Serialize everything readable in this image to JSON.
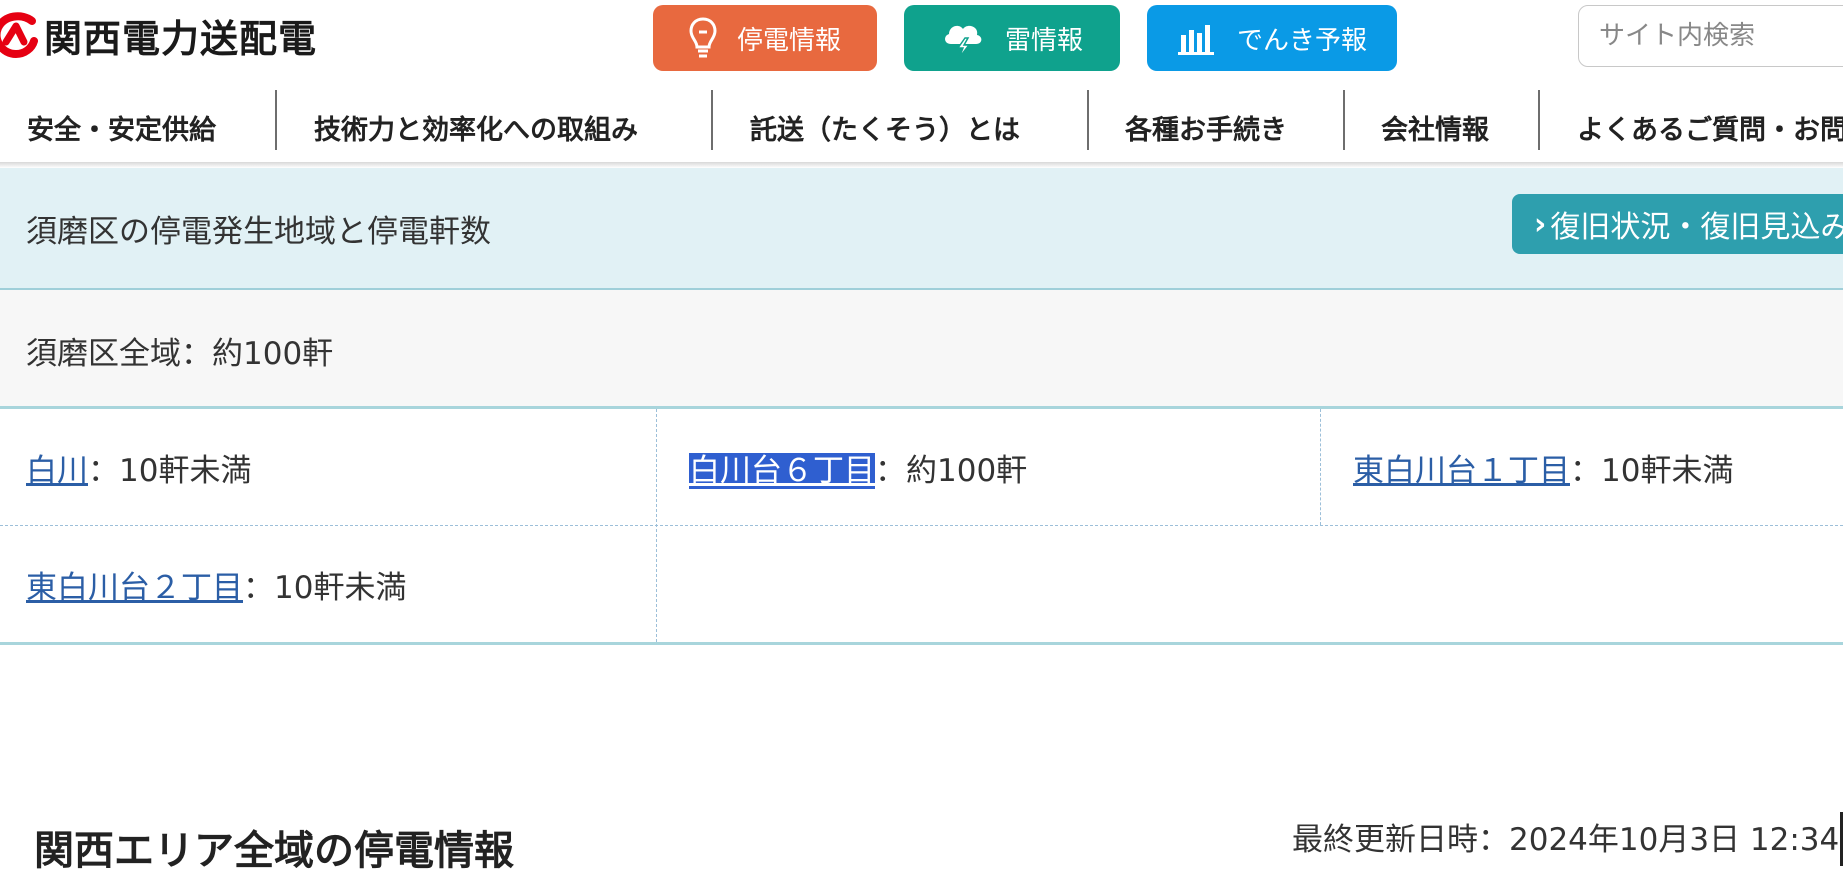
{
  "brand": {
    "name": "関西電力送配電",
    "red": "#e60012"
  },
  "header_buttons": [
    {
      "label": "停電情報",
      "icon": "lightbulb-icon",
      "color": "#e8693f"
    },
    {
      "label": "雷情報",
      "icon": "thunder-cloud-icon",
      "color": "#0fa28d"
    },
    {
      "label": "でんき予報",
      "icon": "bar-chart-icon",
      "color": "#0a9ae6"
    }
  ],
  "search": {
    "placeholder": "サイト内検索"
  },
  "nav": {
    "items": [
      "安全・安定供給",
      "技術力と効率化への取組み",
      "託送（たくそう）とは",
      "各種お手続き",
      "会社情報",
      "よくあるご質問・お問"
    ]
  },
  "outage": {
    "area_title": "須磨区の停電発生地域と停電軒数",
    "restore_button": "復旧状況・復旧見込み",
    "ward_total": "須磨区全域：約100軒",
    "areas": [
      {
        "name": "白川",
        "count": "：10軒未満"
      },
      {
        "name": "白川台６丁目",
        "count": "：約100軒"
      },
      {
        "name": "東白川台１丁目",
        "count": "：10軒未満"
      },
      {
        "name": "東白川台２丁目",
        "count": "：10軒未満"
      }
    ]
  },
  "kansai": {
    "title": "関西エリア全域の停電情報",
    "updated": "最終更新日時：2024年10月3日 12:34"
  },
  "colors": {
    "area_header_bg": "#e1f1f5",
    "restore_button_bg": "#2e9fae",
    "link": "#2b5ea6",
    "selection": "#2f5fd0"
  }
}
